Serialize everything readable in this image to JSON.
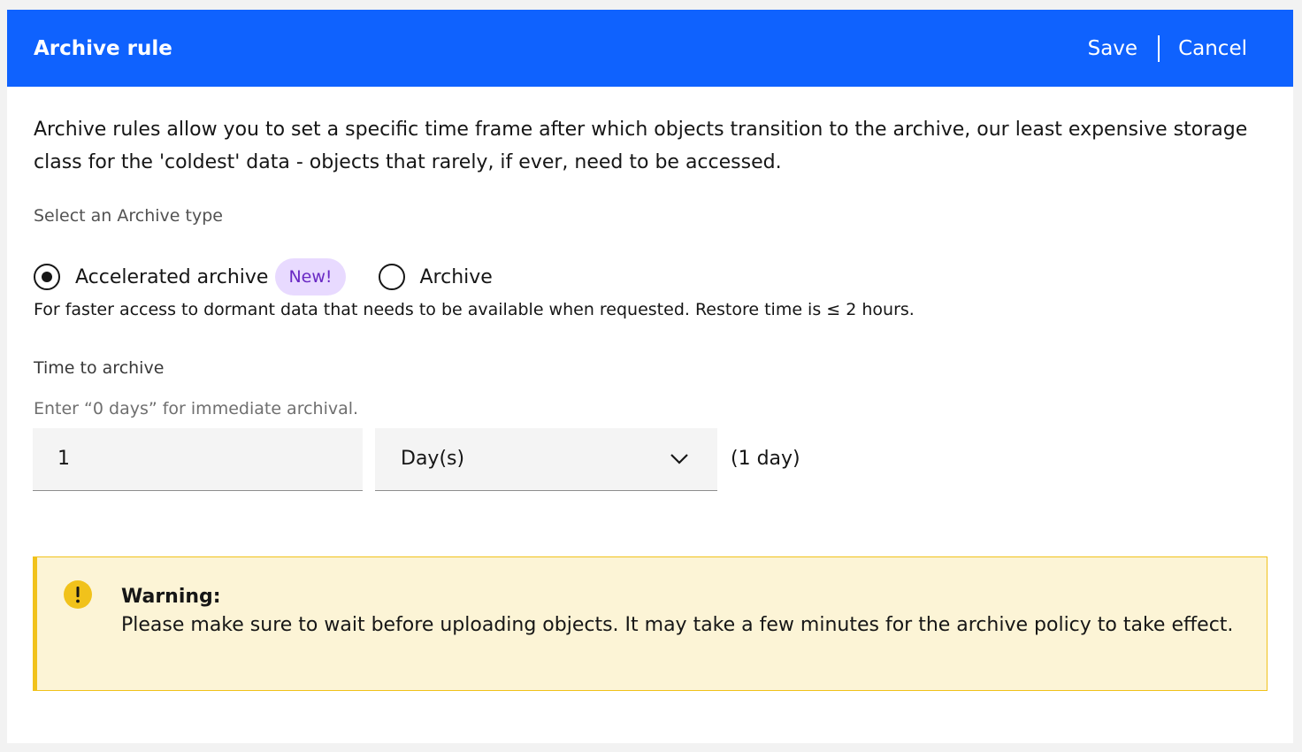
{
  "header": {
    "title": "Archive rule",
    "save_label": "Save",
    "cancel_label": "Cancel"
  },
  "description": "Archive rules allow you to set a specific time frame after which objects transition to the archive, our least expensive storage class for the 'coldest' data - objects that rarely, if ever, need to be accessed.",
  "archive_type": {
    "label": "Select an Archive type",
    "options": [
      {
        "label": "Accelerated archive",
        "badge": "New!",
        "selected": true
      },
      {
        "label": "Archive",
        "selected": false
      }
    ],
    "helper": "For faster access to dormant data that needs to be available when requested. Restore time is ≤ 2 hours."
  },
  "time_to_archive": {
    "label": "Time to archive",
    "hint": "Enter “0 days” for immediate archival.",
    "value": "1",
    "unit": "Day(s)",
    "duration_text": "(1 day)"
  },
  "warning": {
    "title": "Warning:",
    "text": "Please make sure to wait before uploading objects. It may take a few minutes for the archive policy to take effect."
  },
  "colors": {
    "header_bg": "#0f62fe",
    "badge_bg": "#e8daff",
    "badge_text": "#6929c4",
    "warning_bg": "#fcf4d6",
    "warning_accent": "#f1c21b"
  },
  "icons": {
    "select": "chevron-down-icon",
    "warning": "warning-icon"
  }
}
